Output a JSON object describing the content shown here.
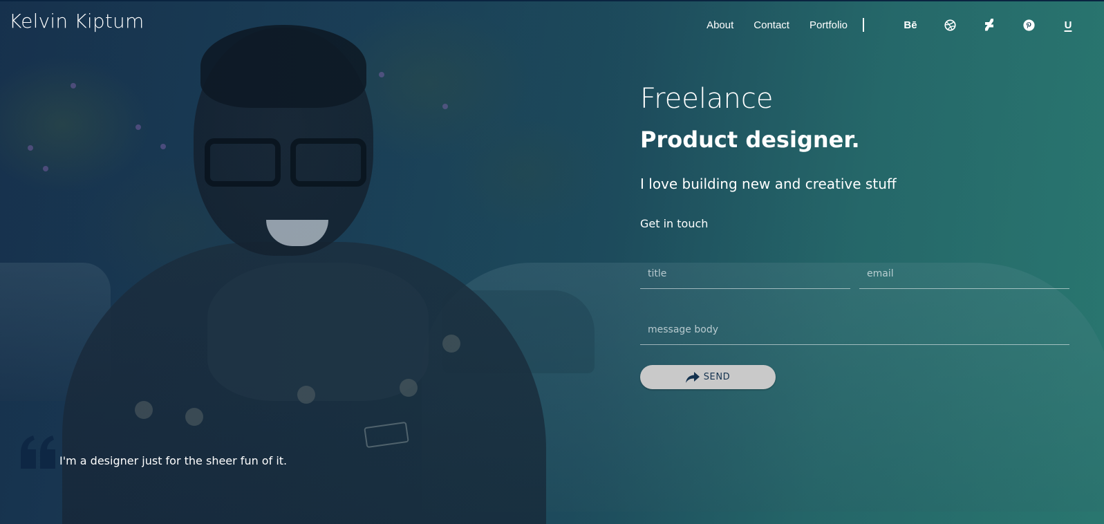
{
  "header": {
    "brand": "Kelvin Kiptum",
    "nav": [
      {
        "label": "About"
      },
      {
        "label": "Contact"
      },
      {
        "label": "Portfolio"
      }
    ],
    "social": [
      {
        "icon": "behance-icon",
        "text": "Bē"
      },
      {
        "icon": "dribbble-icon"
      },
      {
        "icon": "deviantart-icon"
      },
      {
        "icon": "pinterest-icon"
      },
      {
        "icon": "upwork-icon",
        "text": "U"
      }
    ]
  },
  "hero": {
    "line1": "Freelance",
    "line2": "Product designer.",
    "tagline": "I love building new and creative stuff",
    "contact_heading": "Get in touch"
  },
  "form": {
    "title_placeholder": "title",
    "email_placeholder": "email",
    "message_placeholder": "message body",
    "send_label": "SEND"
  },
  "quote": {
    "text": "I'm a designer just for the sheer fun of it."
  },
  "colors": {
    "button_bg": "#c9c9c9",
    "button_text": "#14324f",
    "quote_mark": "#0e2744"
  }
}
